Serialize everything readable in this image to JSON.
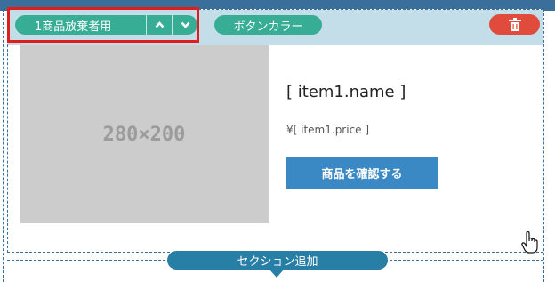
{
  "toolbar": {
    "block_name": "1商品放棄者用",
    "button_color_label": "ボタンカラー",
    "move_up_icon": "chevron-up-icon",
    "move_down_icon": "chevron-down-icon",
    "delete_icon": "trash-icon"
  },
  "content": {
    "image_placeholder": "280×200",
    "item_name": "[ item1.name ]",
    "item_price": "¥[ item1.price ]",
    "confirm_button": "商品を確認する"
  },
  "footer": {
    "add_section": "セクション追加"
  },
  "colors": {
    "toolbar_bg": "#c3dde9",
    "pill_green": "#37ad95",
    "delete_red": "#e14b3c",
    "highlight_red": "#e21b1b",
    "button_blue": "#3a88c4",
    "section_blue": "#287fa6"
  }
}
